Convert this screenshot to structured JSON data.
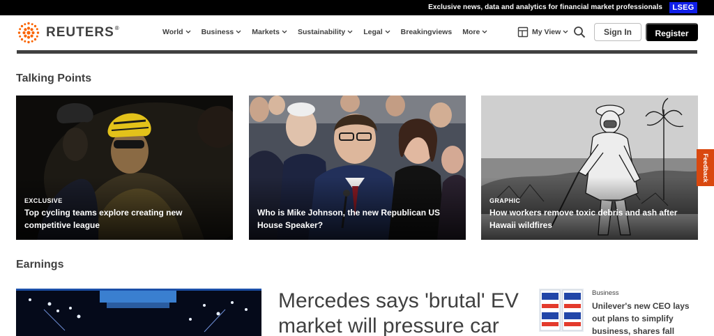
{
  "topbar": {
    "promo_text": "Exclusive news, data and analytics for financial market professionals",
    "lseg_label": "LSEG"
  },
  "header": {
    "brand": "REUTERS",
    "brand_mark": "®",
    "nav": [
      {
        "label": "World",
        "has_dropdown": true
      },
      {
        "label": "Business",
        "has_dropdown": true
      },
      {
        "label": "Markets",
        "has_dropdown": true
      },
      {
        "label": "Sustainability",
        "has_dropdown": true
      },
      {
        "label": "Legal",
        "has_dropdown": true
      },
      {
        "label": "Breakingviews",
        "has_dropdown": false
      },
      {
        "label": "More",
        "has_dropdown": true
      }
    ],
    "my_view_label": "My View",
    "sign_in_label": "Sign In",
    "register_label": "Register"
  },
  "talking_points": {
    "title": "Talking Points",
    "cards": [
      {
        "kicker": "EXCLUSIVE",
        "headline": "Top cycling teams explore creating new competitive league"
      },
      {
        "kicker": "",
        "headline": "Who is Mike Johnson, the new Republican US House Speaker?"
      },
      {
        "kicker": "GRAPHIC",
        "headline": "How workers remove toxic debris and ash after Hawaii wildfires"
      }
    ]
  },
  "earnings": {
    "title": "Earnings",
    "lead_headline": "Mercedes says 'brutal' EV market will pressure car",
    "side_story": {
      "category": "Business",
      "headline": "Unilever's new CEO lays out plans to simplify business, shares fall"
    }
  },
  "feedback_label": "Feedback",
  "colors": {
    "brand_orange": "#fa6400",
    "lseg_blue": "#0f1ee8",
    "text_dark": "#404040",
    "feedback_orange": "#d9480f"
  }
}
